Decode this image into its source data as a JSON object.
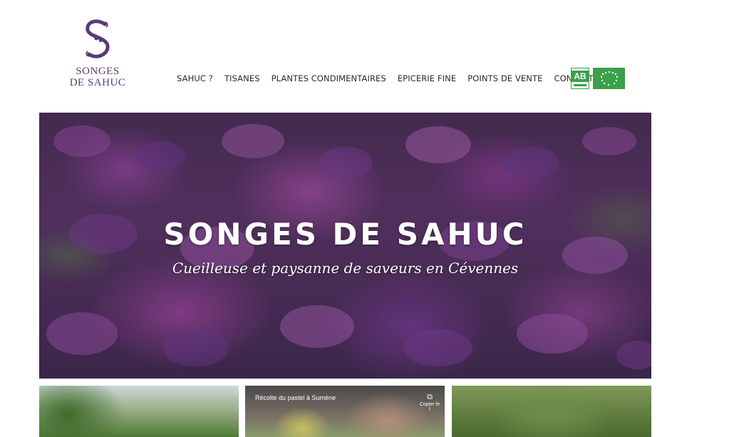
{
  "brand": {
    "logo_line1": "SONGES",
    "logo_line2": "DE SAHUC",
    "accent_color": "#5a3a78"
  },
  "nav": {
    "items": [
      {
        "label": "SAHUC ?"
      },
      {
        "label": "TISANES"
      },
      {
        "label": "PLANTES CONDIMENTAIRES"
      },
      {
        "label": "EPICERIE FINE"
      },
      {
        "label": "POINTS DE VENTE"
      },
      {
        "label": "CONTACT"
      }
    ]
  },
  "badges": {
    "ab_label": "AB",
    "eu_color": "#3aa04a"
  },
  "hero": {
    "title": "SONGES DE SAHUC",
    "subtitle": "Cueilleuse et paysanne de saveurs en Cévennes"
  },
  "thumbnails": {
    "video_title": "Récolte du pastel à Sumène",
    "video_copy": "Copier le l"
  }
}
